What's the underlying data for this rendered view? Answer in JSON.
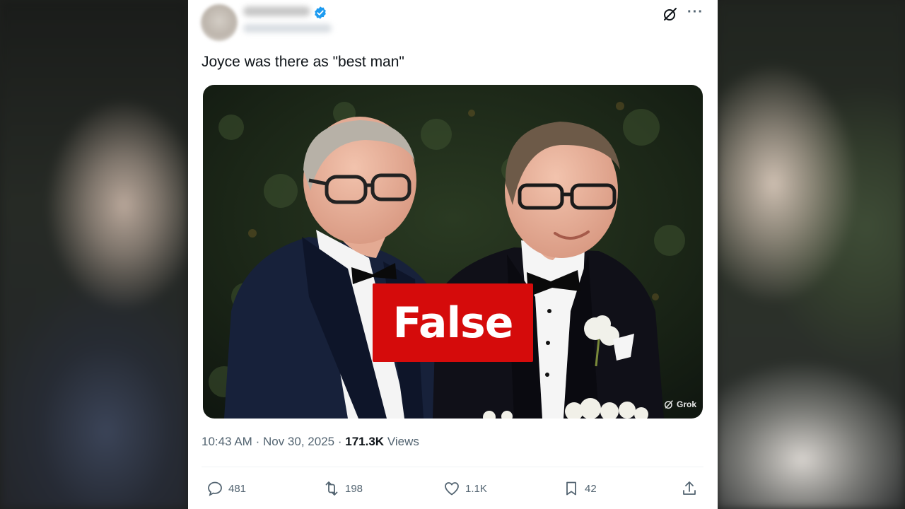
{
  "tweet": {
    "text": "Joyce was there as \"best man\"",
    "time": "10:43 AM",
    "separator1": "·",
    "date": "Nov 30, 2025",
    "separator2": "·",
    "views_count": "171.3K",
    "views_label": "Views"
  },
  "image": {
    "overlay_label": "False",
    "watermark": "Grok"
  },
  "actions": {
    "replies": "481",
    "reposts": "198",
    "likes": "1.1K",
    "bookmarks": "42"
  },
  "colors": {
    "badge_red": "#d50b0b",
    "verified_blue": "#1d9bf0",
    "text_secondary": "#536471"
  },
  "icons": [
    "verified-badge-icon",
    "grok-icon",
    "more-icon",
    "reply-icon",
    "repost-icon",
    "like-icon",
    "bookmark-icon",
    "share-icon"
  ]
}
